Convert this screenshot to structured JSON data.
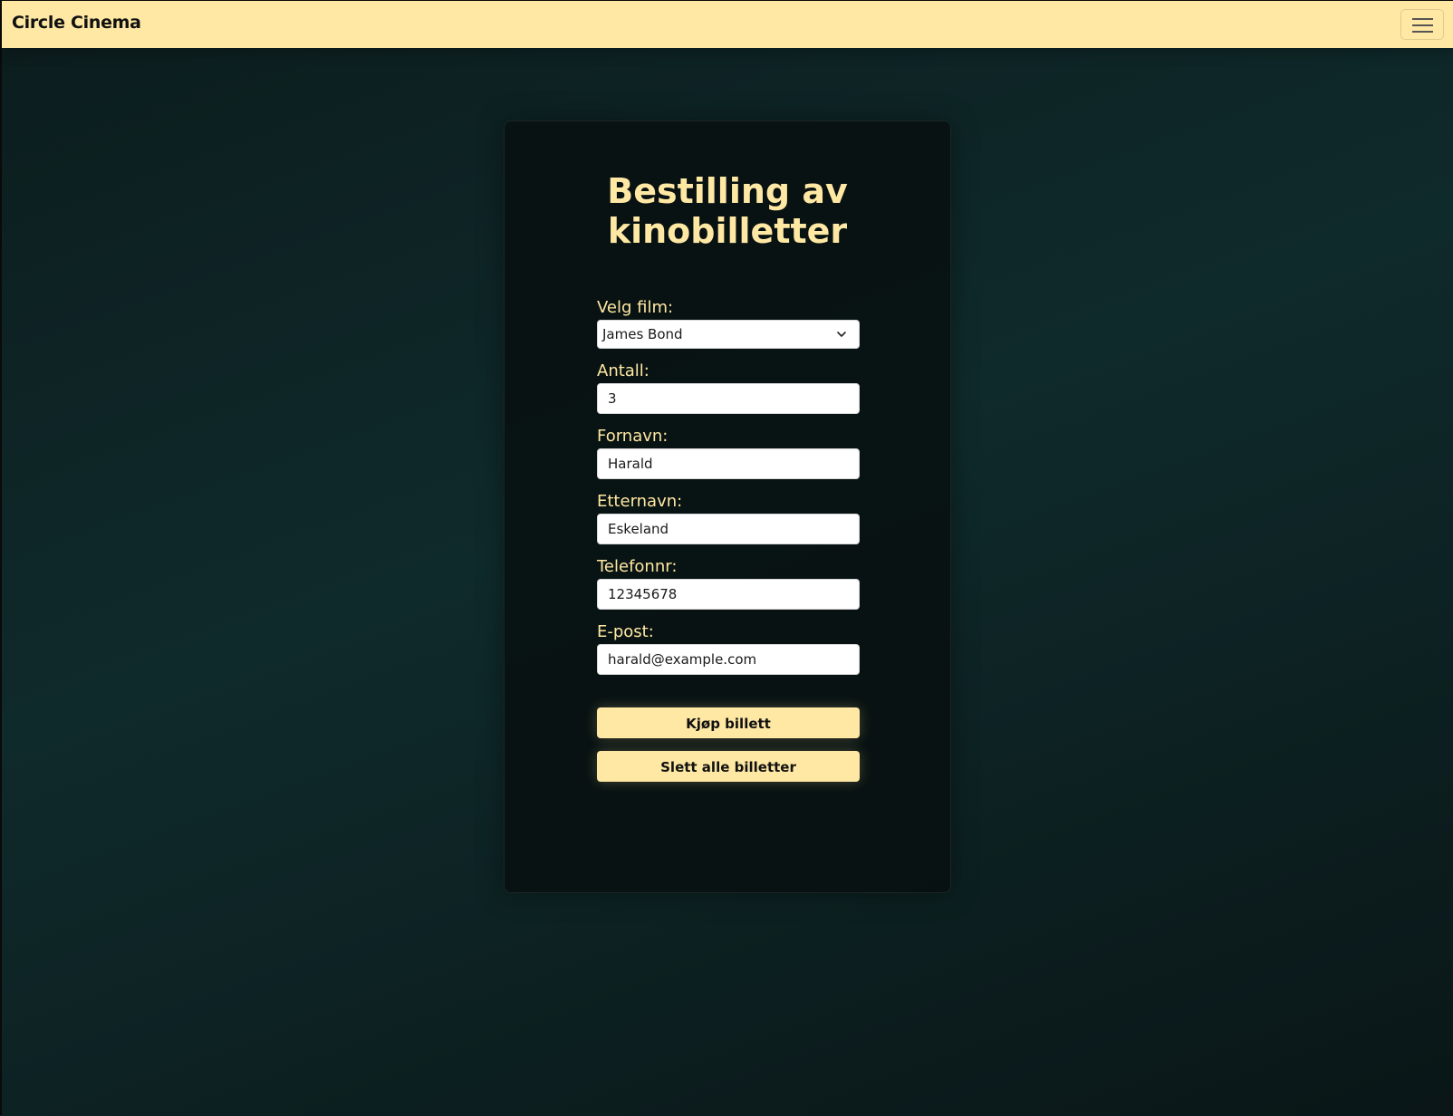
{
  "navbar": {
    "brand": "Circle Cinema",
    "toggler_icon": "hamburger-menu-icon"
  },
  "card": {
    "title": "Bestilling av kinobilletter"
  },
  "form": {
    "film": {
      "label": "Velg film:",
      "selected": "James Bond",
      "icon": "chevron-down-icon"
    },
    "antall": {
      "label": "Antall:",
      "value": "3"
    },
    "fornavn": {
      "label": "Fornavn:",
      "value": "Harald"
    },
    "etternavn": {
      "label": "Etternavn:",
      "value": "Eskeland"
    },
    "telefonnr": {
      "label": "Telefonnr:",
      "value": "12345678"
    },
    "epost": {
      "label": "E-post:",
      "value": "harald@example.com"
    },
    "buy_button": "Kjøp billett",
    "delete_button": "Slett alle billetter"
  },
  "colors": {
    "accent": "#ffe8a3",
    "background": "#0f2a2b",
    "card": "#0b1414"
  }
}
